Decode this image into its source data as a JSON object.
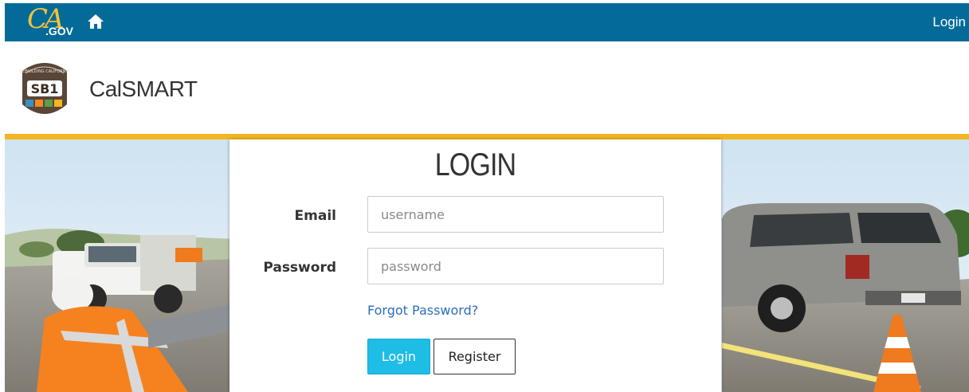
{
  "topbar": {
    "logo_ca": "CA",
    "logo_gov": ".GOV",
    "home_icon": "home-icon",
    "login_label": "Login"
  },
  "brand": {
    "logo_text": "SB1",
    "logo_arc_text": "REBUILDING CALIFORNIA",
    "app_title": "CalSMART"
  },
  "login": {
    "title": "LOGIN",
    "email_label": "Email",
    "email_placeholder": "username",
    "email_value": "",
    "password_label": "Password",
    "password_placeholder": "password",
    "password_value": "",
    "forgot_label": "Forgot Password?",
    "login_button": "Login",
    "register_button": "Register"
  },
  "colors": {
    "topbar": "#046b99",
    "gold_rule": "#f3b520",
    "login_button": "#1dbde6",
    "link": "#2a6ebb"
  }
}
